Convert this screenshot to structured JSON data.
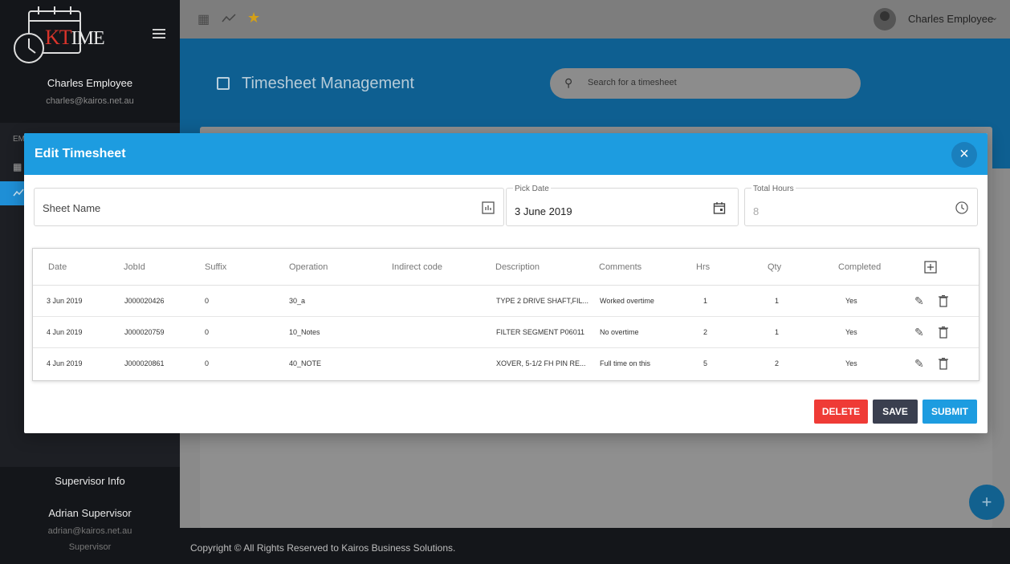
{
  "app": {
    "logo_kt": "KT",
    "logo_ime": "IME"
  },
  "sidebar": {
    "user_name": "Charles Employee",
    "user_email": "charles@kairos.net.au",
    "section_label": "EM",
    "supervisor_title": "Supervisor Info",
    "supervisor_name": "Adrian Supervisor",
    "supervisor_email": "adrian@kairos.net.au",
    "supervisor_role": "Supervisor"
  },
  "topbar": {
    "user_name": "Charles Employee"
  },
  "header": {
    "title": "Timesheet Management",
    "search_placeholder": "Search for a timesheet"
  },
  "footer": {
    "copyright": "Copyright © All Rights Reserved to Kairos Business Solutions."
  },
  "modal": {
    "title": "Edit Timesheet",
    "sheet_name_placeholder": "Sheet Name",
    "pick_date_label": "Pick Date",
    "pick_date_value": "3 June 2019",
    "total_hours_label": "Total Hours",
    "total_hours_value": "8",
    "columns": [
      "Date",
      "JobId",
      "Suffix",
      "Operation",
      "Indirect code",
      "Description",
      "Comments",
      "Hrs",
      "Qty",
      "Completed"
    ],
    "rows": [
      [
        "3 Jun 2019",
        "J000020426",
        "0",
        "30_a",
        "",
        "TYPE 2 DRIVE SHAFT,FIL...",
        "Worked overtime",
        "1",
        "1",
        "Yes"
      ],
      [
        "4 Jun 2019",
        "J000020759",
        "0",
        "10_Notes",
        "",
        "FILTER SEGMENT P06011",
        "No overtime",
        "2",
        "1",
        "Yes"
      ],
      [
        "4 Jun 2019",
        "J000020861",
        "0",
        "40_NOTE",
        "",
        "XOVER, 5-1/2 FH PIN RE...",
        "Full time on this",
        "5",
        "2",
        "Yes"
      ]
    ],
    "buttons": {
      "delete": "DELETE",
      "save": "SAVE",
      "submit": "SUBMIT"
    }
  },
  "colors": {
    "primary": "#1d9ce0",
    "danger": "#ef3b36",
    "dark": "#3a3f4f",
    "star": "#d4a017"
  }
}
